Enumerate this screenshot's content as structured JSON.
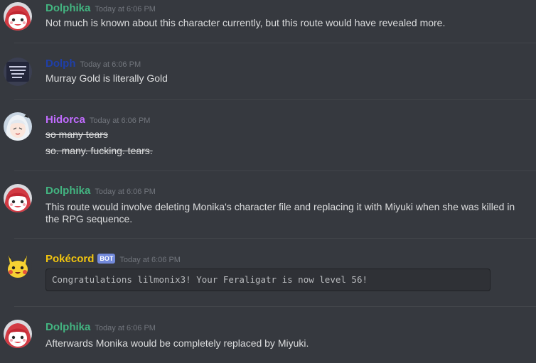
{
  "colors": {
    "background": "#36393f",
    "dolphika": "#43b581",
    "dolph": "#1f3fa8",
    "hidorca": "#c16cff",
    "pokecord": "#f1c40f",
    "bot_tag": "#7289da",
    "timestamp": "#72767d"
  },
  "messages": [
    {
      "username": "Dolphika",
      "timestamp": "Today at 6:06 PM",
      "avatar_icon": "red-hair-girl-avatar",
      "lines": [
        "Not much is known about this character currently, but this route would have revealed more."
      ]
    },
    {
      "username": "Dolph",
      "timestamp": "Today at 6:06 PM",
      "avatar_icon": "dark-image-avatar",
      "lines": [
        "Murray Gold is literally Gold"
      ]
    },
    {
      "username": "Hidorca",
      "timestamp": "Today at 6:06 PM",
      "avatar_icon": "white-hair-girl-avatar",
      "lines": [
        "so many tears",
        "so. many. fucking. tears."
      ]
    },
    {
      "username": "Dolphika",
      "timestamp": "Today at 6:06 PM",
      "avatar_icon": "red-hair-girl-avatar",
      "lines": [
        "This route would involve deleting Monika's character file and replacing it with Miyuki when she was killed in",
        "the RPG sequence."
      ]
    },
    {
      "username": "Pokécord",
      "bot_tag": "BOT",
      "timestamp": "Today at 6:06 PM",
      "avatar_icon": "pikachu-avatar",
      "code": "Congratulations lilmonix3! Your Feraligatr is now level 56!"
    },
    {
      "username": "Dolphika",
      "timestamp": "Today at 6:06 PM",
      "avatar_icon": "red-hair-girl-avatar",
      "lines": [
        "Afterwards Monika would be completely replaced by Miyuki."
      ]
    }
  ]
}
